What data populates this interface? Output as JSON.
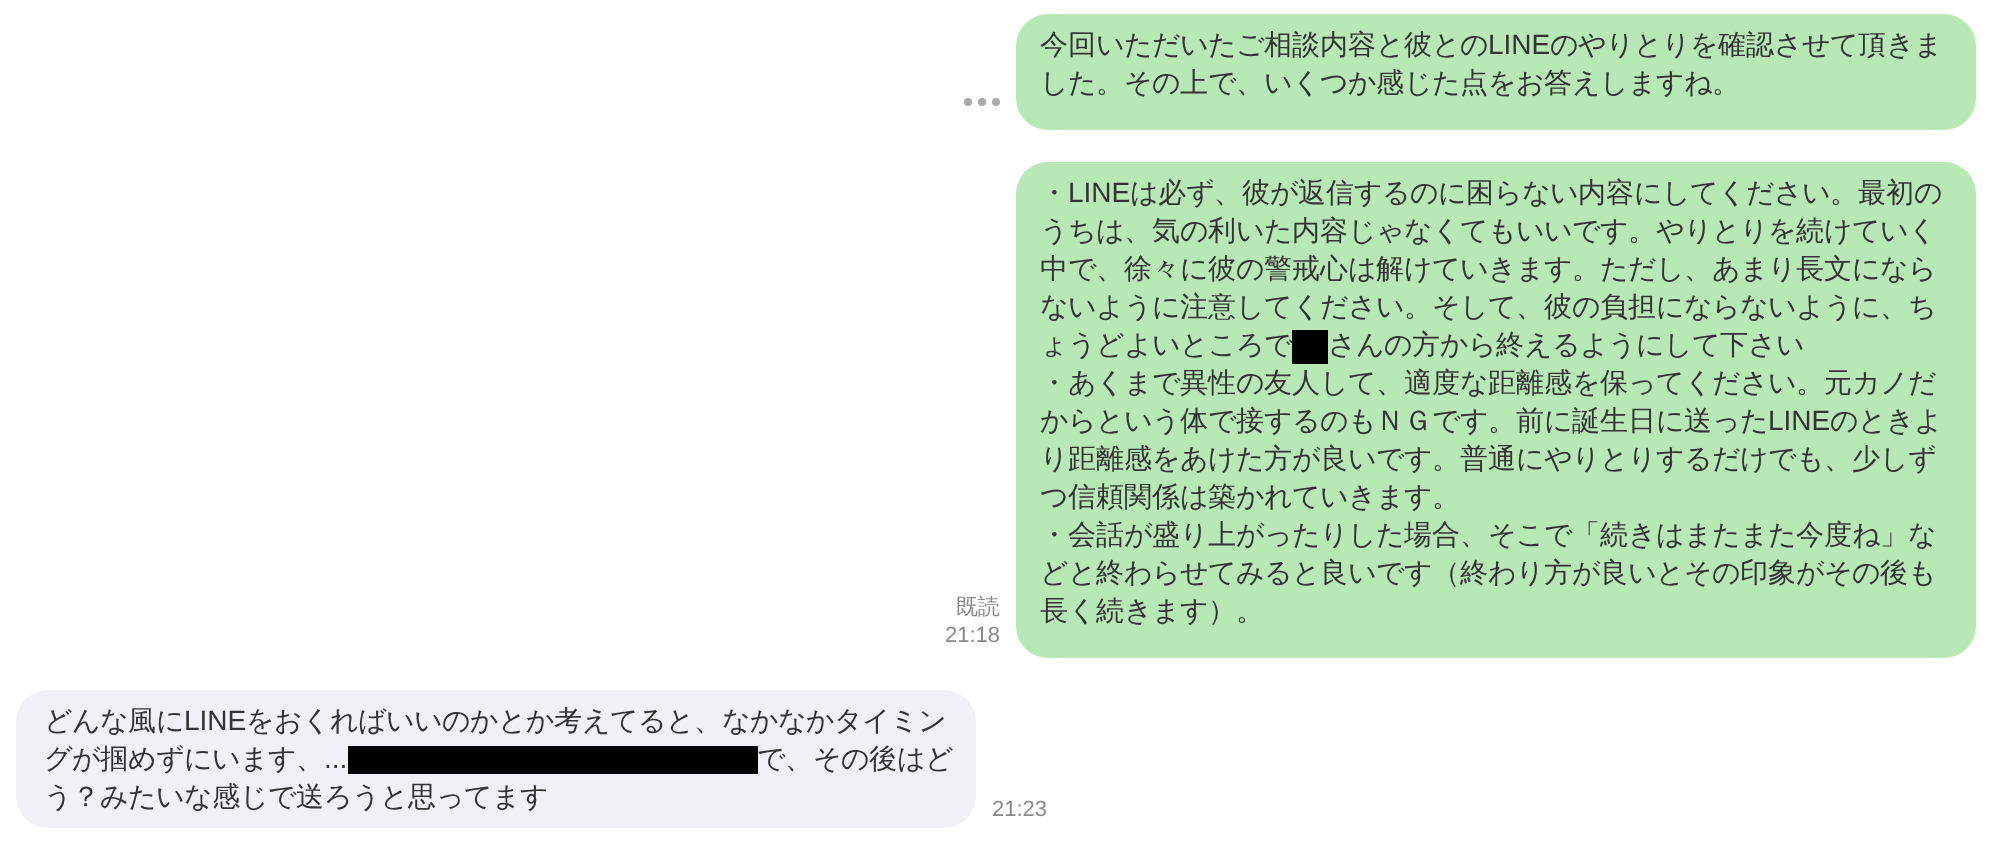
{
  "messages": [
    {
      "kind": "outgoing",
      "show_typing": true,
      "parts": [
        {
          "kind": "text",
          "text": "今回いただいたご相談内容と彼とのLINEのやりとりを確認させて頂きました。その上で、いくつか感じた点をお答えしますね。"
        }
      ]
    },
    {
      "kind": "outgoing",
      "show_typing": false,
      "read_label": "既読",
      "time": "21:18",
      "parts": [
        {
          "kind": "text",
          "text": "・LINEは必ず、彼が返信するのに困らない内容にしてください。最初のうちは、気の利いた内容じゃなくてもいいです。やりとりを続けていく中で、徐々に彼の警戒心は解けていきます。ただし、あまり長文にならないように注意してください。そして、彼の負担にならないように、ちょうどよいところで"
        },
        {
          "kind": "redacted_short"
        },
        {
          "kind": "text",
          "text": "さんの方から終えるようにして下さい"
        },
        {
          "kind": "line_break"
        },
        {
          "kind": "text",
          "text": "・あくまで異性の友人して、適度な距離感を保ってください。元カノだからという体で接するのもＮＧです。前に誕生日に送ったLINEのときより距離感をあけた方が良いです。普通にやりとりするだけでも、少しずつ信頼関係は築かれていきます。"
        },
        {
          "kind": "line_break"
        },
        {
          "kind": "text",
          "text": "・会話が盛り上がったりした場合、そこで「続きはまたまた今度ね」などと終わらせてみると良いです（終わり方が良いとその印象がその後も長く続きます）。"
        }
      ]
    },
    {
      "kind": "incoming",
      "show_typing": false,
      "time": "21:23",
      "parts": [
        {
          "kind": "text",
          "text": "どんな風にLINEをおくればいいのかとか考えてると、なかなかタイミングが掴めずにいます、..."
        },
        {
          "kind": "redacted_long"
        },
        {
          "kind": "text",
          "text": "で、その後はどう？みたいな感じで送ろうと思ってます"
        }
      ]
    }
  ]
}
